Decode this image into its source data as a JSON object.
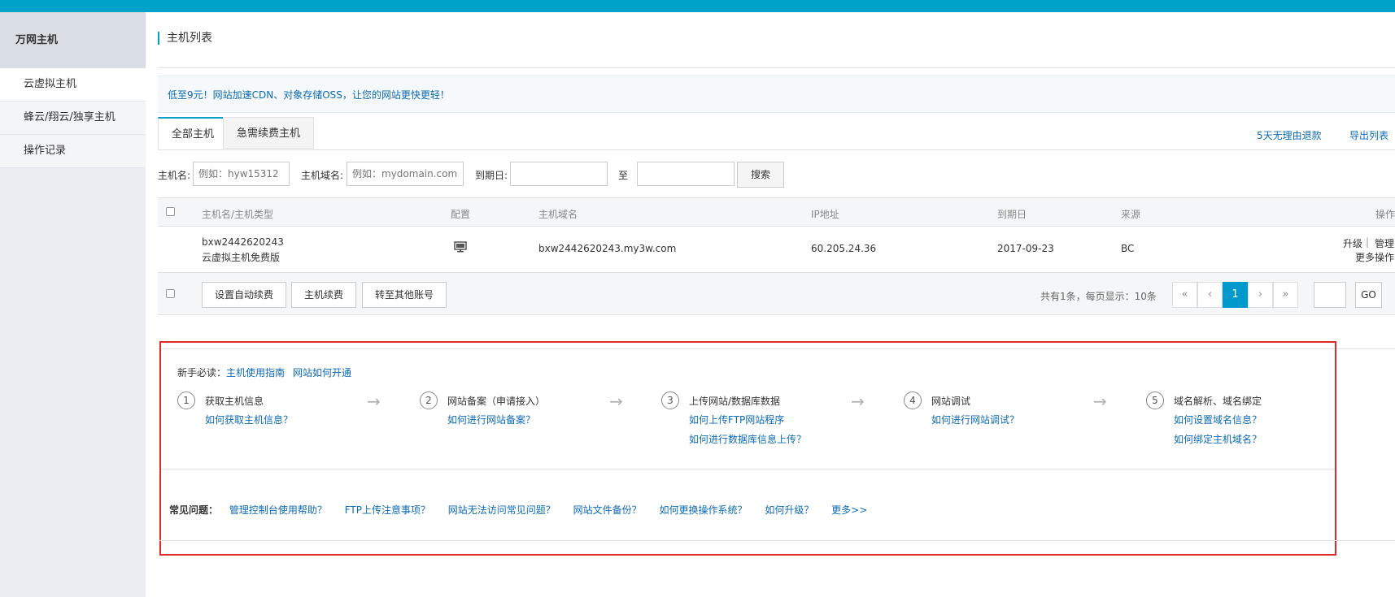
{
  "sidebar": {
    "title": "万网主机",
    "items": [
      {
        "label": "云虚拟主机"
      },
      {
        "label": "蜂云/翔云/独享主机"
      },
      {
        "label": "操作记录"
      }
    ]
  },
  "page_title": "主机列表",
  "promo": "低至9元！网站加速CDN、对象存储OSS，让您的网站更快更轻！",
  "tabs": [
    {
      "label": "全部主机"
    },
    {
      "label": "急需续费主机"
    }
  ],
  "tab_links": {
    "refund": "5天无理由退款",
    "export": "导出列表"
  },
  "filter": {
    "host_label": "主机名:",
    "host_placeholder": "例如：hyw15312",
    "domain_label": "主机域名:",
    "domain_placeholder": "例如：mydomain.com",
    "expire_label": "到期日:",
    "to_label": "至",
    "search_button": "搜索"
  },
  "table": {
    "headers": [
      "主机名/主机类型",
      "配置",
      "主机域名",
      "IP地址",
      "到期日",
      "来源",
      "操作"
    ],
    "row": {
      "host_name": "bxw2442620243",
      "host_type": "云虚拟主机免费版",
      "domain": "bxw2442620243.my3w.com",
      "ip": "60.205.24.36",
      "expire": "2017-09-23",
      "source": "BC",
      "op_upgrade": "升级",
      "op_sep": "|",
      "op_manage": "管理",
      "op_more": "更多操作"
    }
  },
  "footer": {
    "btn_autorenew": "设置自动续费",
    "btn_renew": "主机续费",
    "btn_transfer": "转至其他账号",
    "pager_info": "共有1条，每页显示：10条",
    "pager": {
      "first": "«",
      "prev": "‹",
      "current": "1",
      "next": "›",
      "last": "»"
    },
    "go": "GO"
  },
  "guide": {
    "newbie_label": "新手必读：",
    "newbie_links": [
      "主机使用指南",
      "网站如何开通"
    ],
    "steps": [
      {
        "num": "1",
        "title": "获取主机信息",
        "links": [
          "如何获取主机信息？"
        ]
      },
      {
        "num": "2",
        "title": "网站备案（申请接入）",
        "links": [
          "如何进行网站备案？"
        ]
      },
      {
        "num": "3",
        "title": "上传网站/数据库数据",
        "links": [
          "如何上传FTP网站程序",
          "如何进行数据库信息上传？"
        ]
      },
      {
        "num": "4",
        "title": "网站调试",
        "links": [
          "如何进行网站调试？"
        ]
      },
      {
        "num": "5",
        "title": "域名解析、域名绑定",
        "links": [
          "如何设置域名信息？",
          "如何绑定主机域名？"
        ]
      }
    ],
    "arrow": "→",
    "faq_label": "常见问题：",
    "faq_links": [
      "管理控制台使用帮助？",
      "FTP上传注意事项？",
      "网站无法访问常见问题？",
      "网站文件备份？",
      "如何更换操作系统？",
      "如何升级？",
      "更多>>"
    ]
  }
}
